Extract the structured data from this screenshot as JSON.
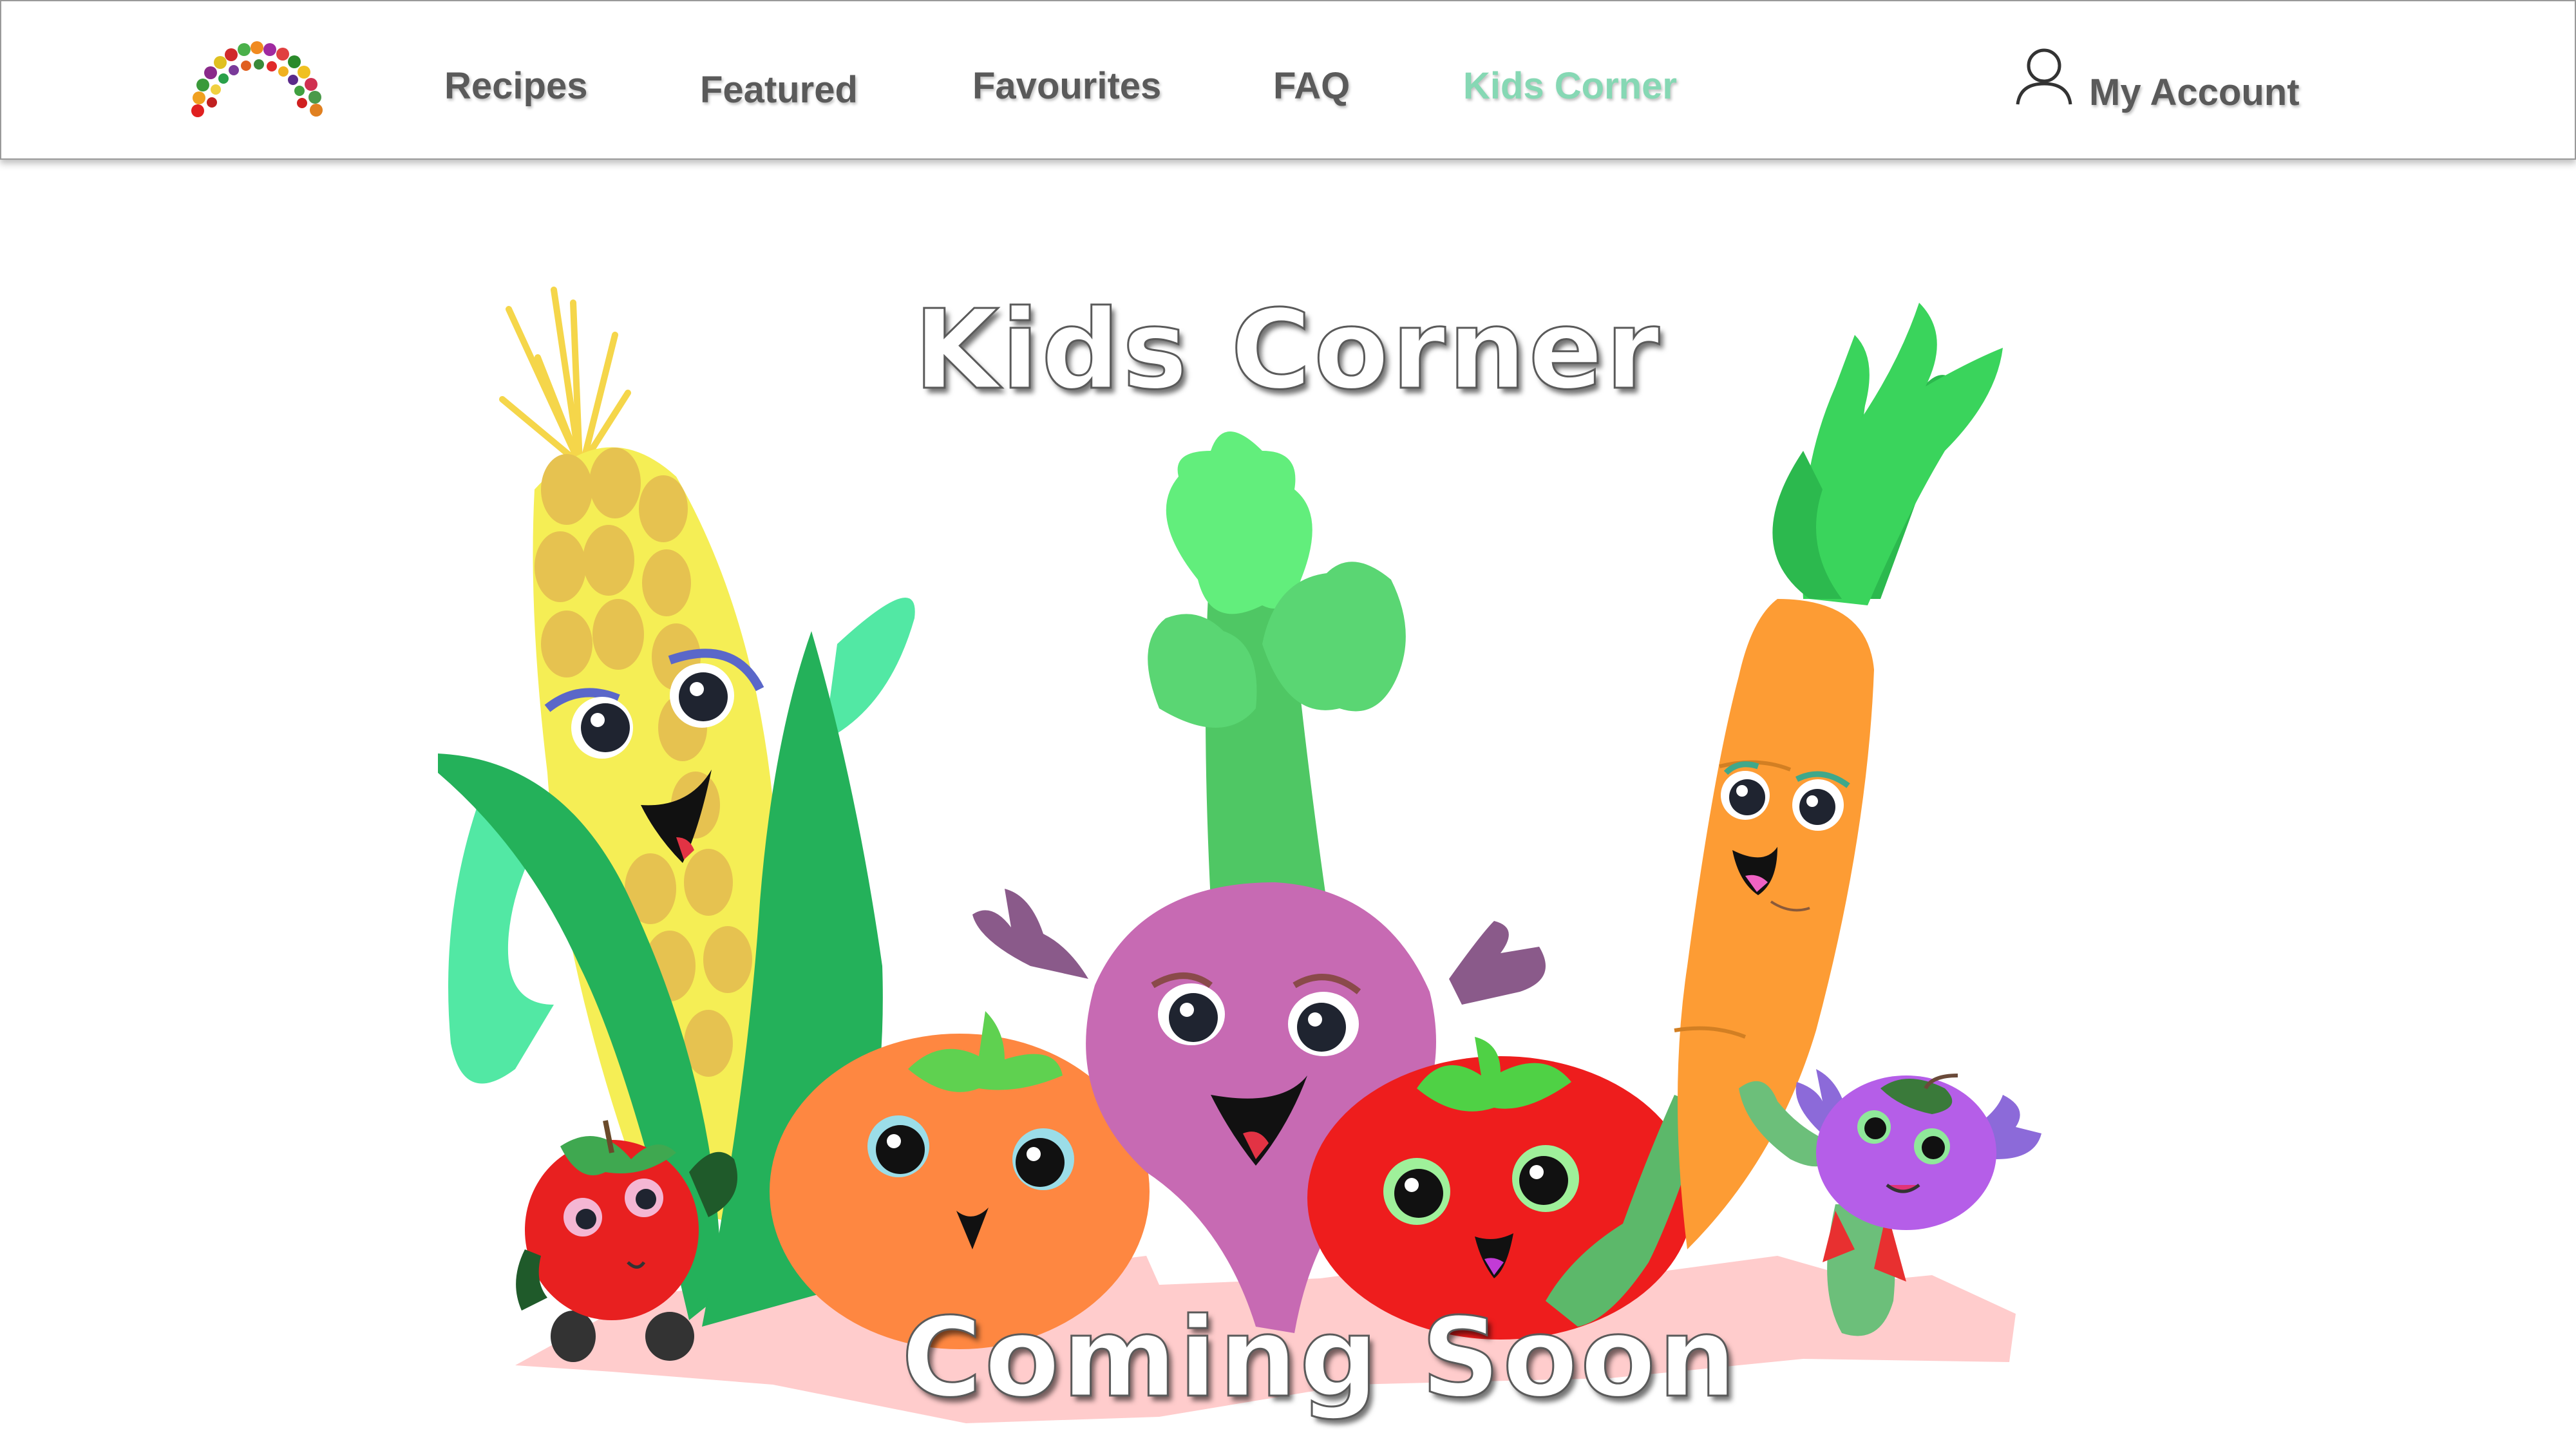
{
  "nav": {
    "logo_name": "veggie-rainbow-logo",
    "items": [
      {
        "label": "Recipes"
      },
      {
        "label": "Featured"
      },
      {
        "label": "Favourites"
      },
      {
        "label": "FAQ"
      },
      {
        "label": "Kids Corner",
        "active": true
      }
    ],
    "account_label": "My Account",
    "account_icon": "user-icon",
    "active_color": "#86d8b4",
    "text_color": "#5a5a5a"
  },
  "hero": {
    "title": "Kids Corner",
    "subtitle": "Coming Soon",
    "illustration": "cartoon-vegetables"
  }
}
